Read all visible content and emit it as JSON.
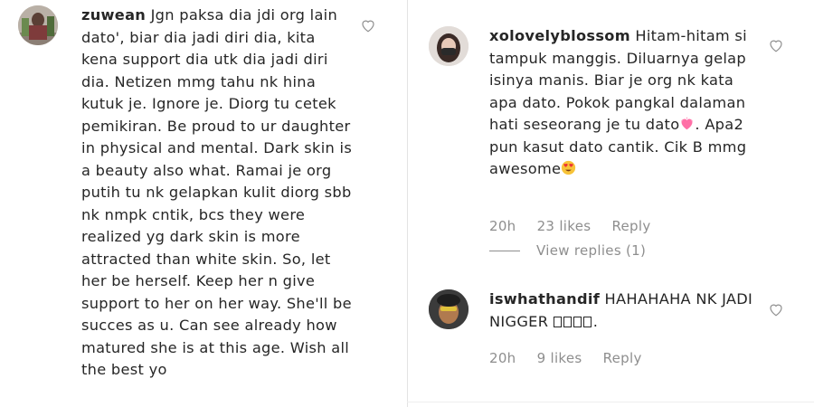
{
  "left_comment": {
    "username": "zuwean",
    "text": "Jgn paksa dia jdi org lain dato', biar dia jadi diri dia, kita kena support dia utk dia jadi diri dia. Netizen mmg tahu nk hina kutuk je. Ignore je. Diorg tu cetek pemikiran. Be proud to ur daughter in physical and mental. Dark skin is a beauty also what. Ramai je org putih tu nk gelapkan kulit diorg sbb nk nmpk cntik, bcs they were realized yg dark skin is more attracted than white skin. So, let her be herself. Keep her n give support to her on her way. She'll be succes as u. Can see already how matured she is at this age. Wish all the best yo"
  },
  "right_comments": [
    {
      "username": "xolovelyblossom",
      "text_part1": "Hitam-hitam si tampuk manggis. Diluarnya gelap isinya manis. Biar je org nk kata apa dato. Pokok pangkal dalaman hati seseorang je tu dato",
      "text_part2": ". Apa2 pun kasut dato cantik. Cik B mmg awesome",
      "emoji1": "heart-emoji",
      "emoji2": "heart-eyes-emoji",
      "time": "20h",
      "likes": "23 likes",
      "reply": "Reply",
      "view_replies": "View replies (1)"
    },
    {
      "username": "iswhathandif",
      "text": "HAHAHAHA NK JADI NIGGER",
      "text_end": ".",
      "time": "20h",
      "likes": "9 likes",
      "reply": "Reply"
    }
  ],
  "icons": {
    "like": "heart-outline-icon"
  },
  "colors": {
    "meta": "#8e8e8e",
    "text": "#262626",
    "heart_outline": "#8e8e8e"
  }
}
